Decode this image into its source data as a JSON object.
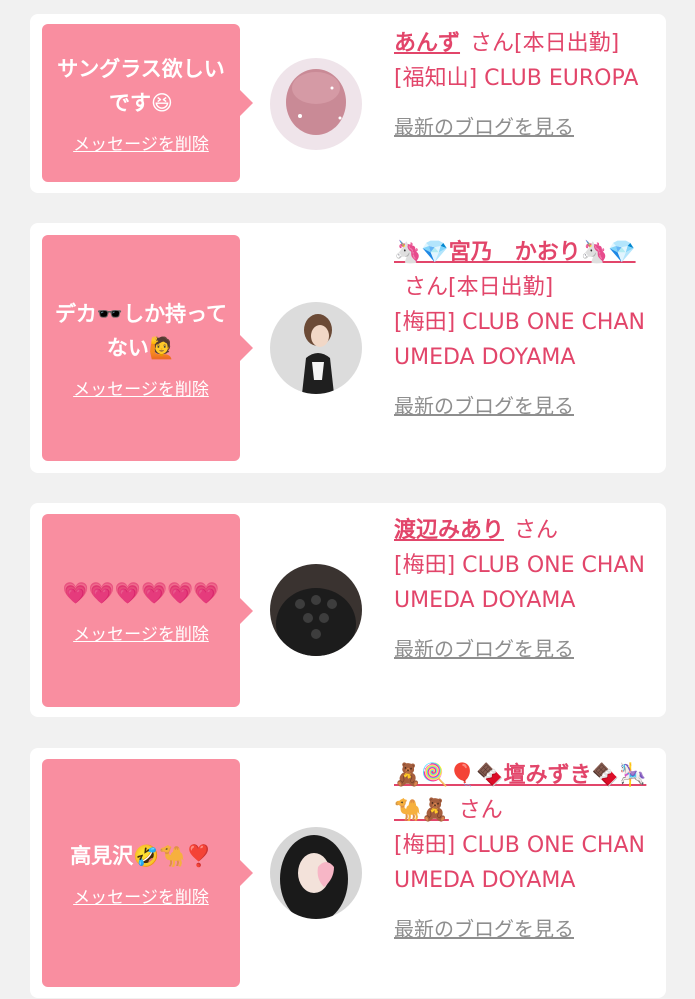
{
  "cards": [
    {
      "message": "サングラス欲しいです😆",
      "delete_label": "メッセージを削除",
      "name": "あんず",
      "honorific": "さん[本日出勤]",
      "shop": "[福知山] CLUB EUROPA",
      "blog_label": "最新のブログを見る"
    },
    {
      "message": "デカ🕶️しか持ってない🙋",
      "delete_label": "メッセージを削除",
      "name": "🦄💎宮乃　かおり🦄💎",
      "honorific": "さん[本日出勤]",
      "shop": "[梅田] CLUB ONE CHAN UMEDA DOYAMA",
      "blog_label": "最新のブログを見る"
    },
    {
      "message": "💗💗💗💗💗💗",
      "delete_label": "メッセージを削除",
      "name": "渡辺みあり",
      "honorific": "さん",
      "shop": "[梅田] CLUB ONE CHAN UMEDA DOYAMA",
      "blog_label": "最新のブログを見る"
    },
    {
      "message": "高見沢🤣🐪❣️",
      "delete_label": "メッセージを削除",
      "name": "🧸🍭🎈🍫壇みずき🍫🎠🐪🧸",
      "honorific": "さん",
      "shop": "[梅田] CLUB ONE CHAN UMEDA DOYAMA",
      "blog_label": "最新のブログを見る"
    }
  ],
  "colors": {
    "accent": "#e2456a",
    "bubble": "#f98ea0",
    "muted": "#8e8e8e",
    "background": "#f1f1f1"
  },
  "icons": {
    "avatar": "profile-photo"
  }
}
